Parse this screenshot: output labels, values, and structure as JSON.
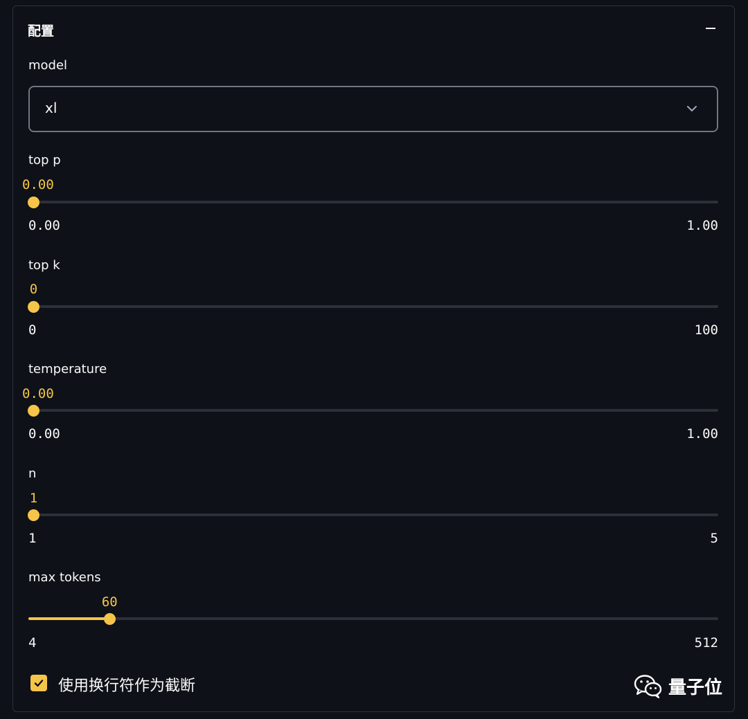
{
  "panel": {
    "title": "配置",
    "collapse_icon": "minus-icon"
  },
  "model": {
    "label": "model",
    "value": "xl",
    "icon": "chevron-down-icon"
  },
  "sliders": {
    "top_p": {
      "label": "top p",
      "value": "0.00",
      "min": "0.00",
      "max": "1.00",
      "fraction": 0
    },
    "top_k": {
      "label": "top k",
      "value": "0",
      "min": "0",
      "max": "100",
      "fraction": 0
    },
    "temperature": {
      "label": "temperature",
      "value": "0.00",
      "min": "0.00",
      "max": "1.00",
      "fraction": 0
    },
    "n": {
      "label": "n",
      "value": "1",
      "min": "1",
      "max": "5",
      "fraction": 0
    },
    "max_tokens": {
      "label": "max tokens",
      "value": "60",
      "min": "4",
      "max": "512",
      "fraction": 0.1102
    }
  },
  "truncate_option": {
    "label": "使用换行符作为截断",
    "checked": true,
    "icon": "checkmark-icon"
  },
  "watermark": {
    "text": "量子位",
    "icon": "wechat-icon"
  },
  "colors": {
    "accent": "#f5c54a",
    "background": "#0e1117",
    "track": "#2d3038",
    "text": "#fafafa"
  }
}
